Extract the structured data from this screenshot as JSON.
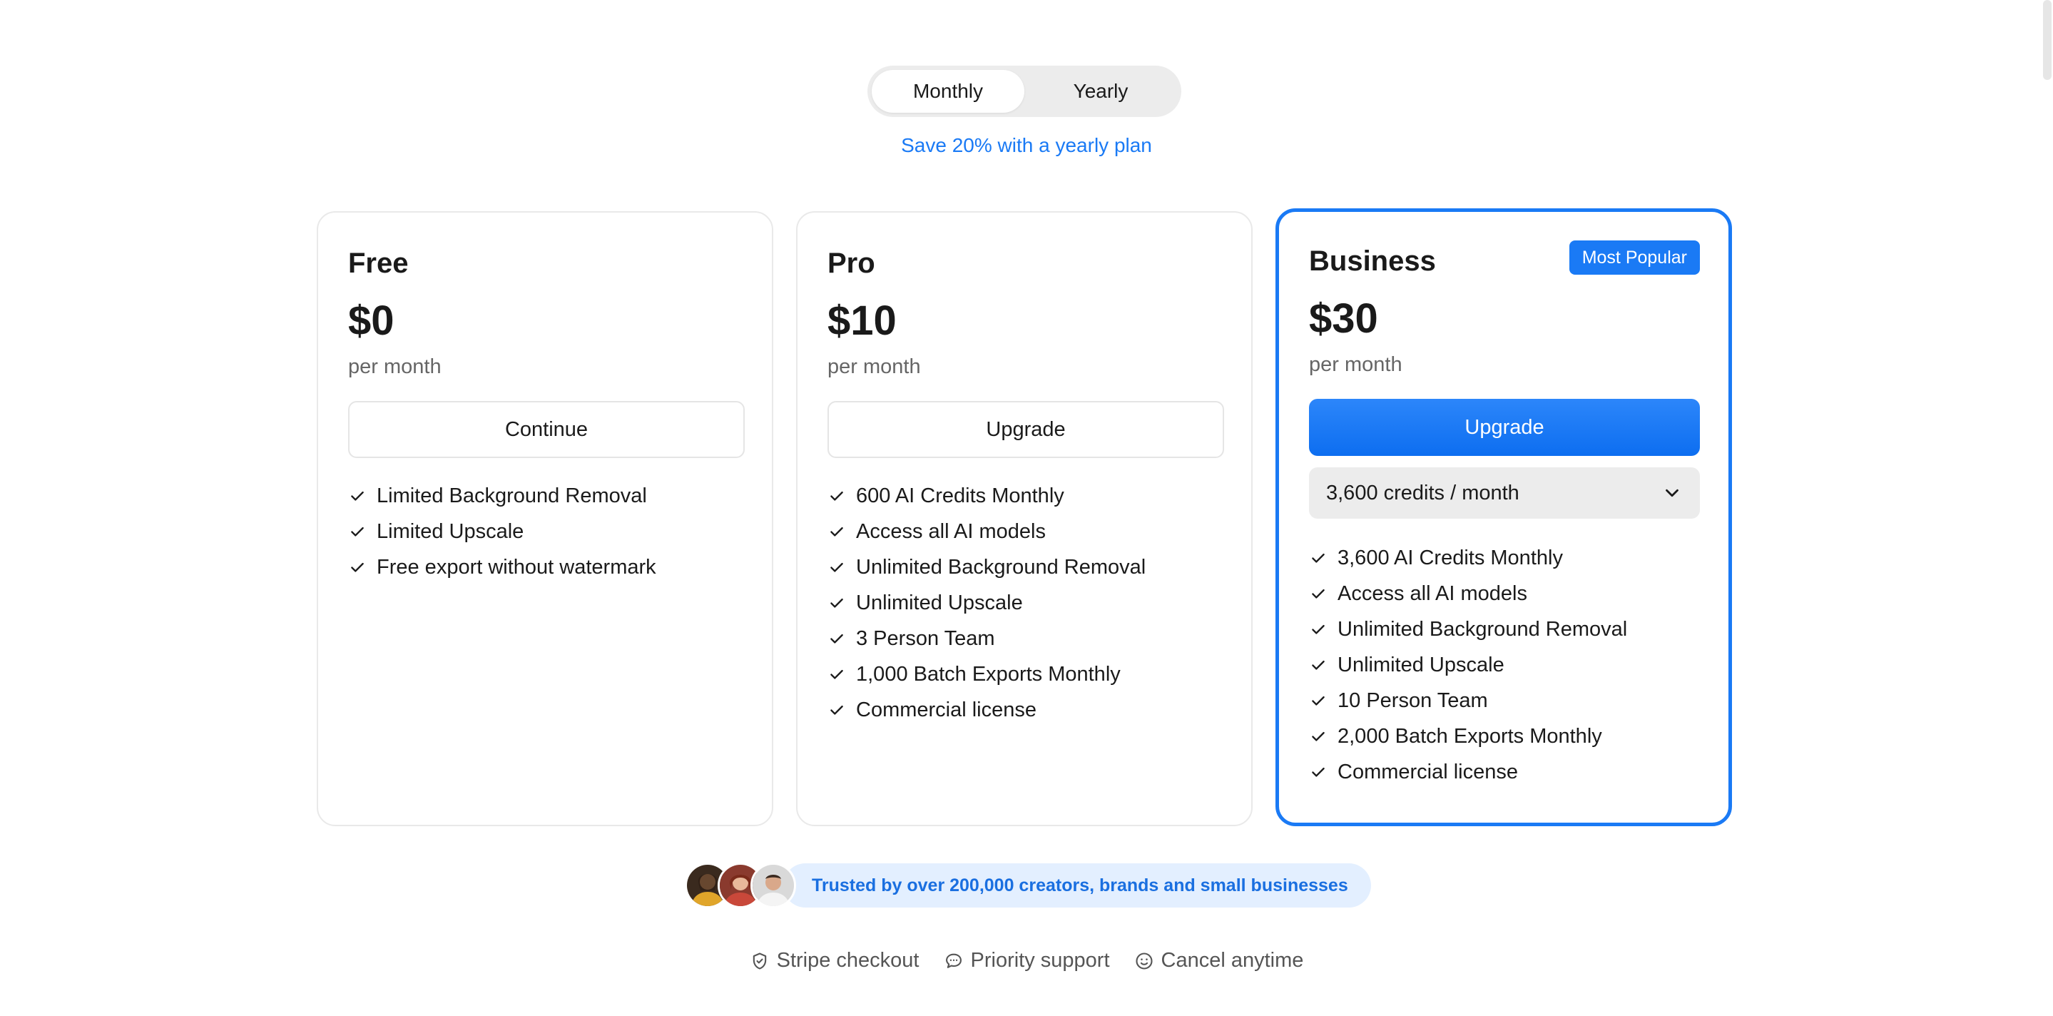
{
  "billing_toggle": {
    "monthly_label": "Monthly",
    "yearly_label": "Yearly",
    "selected": "Monthly",
    "save_note": "Save 20% with a yearly plan"
  },
  "plans": [
    {
      "name": "Free",
      "price": "$0",
      "period": "per month",
      "button_label": "Continue",
      "features": [
        "Limited Background Removal",
        "Limited Upscale",
        "Free export without watermark"
      ]
    },
    {
      "name": "Pro",
      "price": "$10",
      "period": "per month",
      "button_label": "Upgrade",
      "features": [
        "600 AI Credits Monthly",
        "Access all AI models",
        "Unlimited Background Removal",
        "Unlimited Upscale",
        "3 Person Team",
        "1,000 Batch Exports Monthly",
        "Commercial license"
      ]
    },
    {
      "name": "Business",
      "badge": "Most Popular",
      "price": "$30",
      "period": "per month",
      "button_label": "Upgrade",
      "credits_select": "3,600 credits / month",
      "features": [
        "3,600 AI Credits Monthly",
        "Access all AI models",
        "Unlimited Background Removal",
        "Unlimited Upscale",
        "10 Person Team",
        "2,000 Batch Exports Monthly",
        "Commercial license"
      ]
    }
  ],
  "trust": {
    "text": "Trusted by over 200,000 creators, brands and small businesses"
  },
  "assurances": {
    "stripe": "Stripe checkout",
    "support": "Priority support",
    "cancel": "Cancel anytime"
  },
  "colors": {
    "accent": "#1a7af5",
    "trust_bg": "#e3efff"
  }
}
